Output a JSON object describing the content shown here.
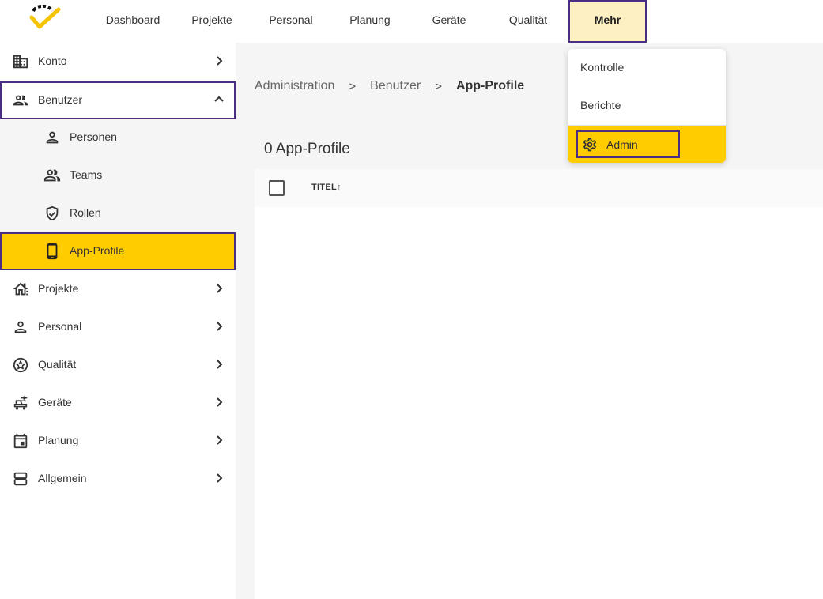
{
  "nav": {
    "items": [
      {
        "label": "Dashboard"
      },
      {
        "label": "Projekte"
      },
      {
        "label": "Personal"
      },
      {
        "label": "Planung"
      },
      {
        "label": "Geräte"
      },
      {
        "label": "Qualität"
      },
      {
        "label": "Mehr"
      }
    ],
    "active": "Mehr"
  },
  "sidebar": {
    "items": [
      {
        "label": "Konto",
        "icon": "building-icon"
      },
      {
        "label": "Benutzer",
        "icon": "users-icon",
        "expanded": true
      },
      {
        "label": "Personen",
        "icon": "person-icon",
        "sub": true
      },
      {
        "label": "Teams",
        "icon": "group-icon",
        "sub": true
      },
      {
        "label": "Rollen",
        "icon": "shield-check-icon",
        "sub": true
      },
      {
        "label": "App-Profile",
        "icon": "smartphone-icon",
        "sub": true,
        "selected": true
      },
      {
        "label": "Projekte",
        "icon": "city-icon"
      },
      {
        "label": "Personal",
        "icon": "person-icon"
      },
      {
        "label": "Qualität",
        "icon": "star-badge-icon"
      },
      {
        "label": "Geräte",
        "icon": "equipment-icon"
      },
      {
        "label": "Planung",
        "icon": "calendar-icon"
      },
      {
        "label": "Allgemein",
        "icon": "storage-icon"
      }
    ]
  },
  "breadcrumb": {
    "items": [
      "Administration",
      "Benutzer",
      "App-Profile"
    ],
    "separator": ">"
  },
  "main": {
    "count_title": "0 App-Profile",
    "table": {
      "columns": [
        {
          "label": "TITEL",
          "sort": "↑"
        }
      ],
      "rows": []
    }
  },
  "dropdown": {
    "items": [
      {
        "label": "Kontrolle"
      },
      {
        "label": "Berichte"
      },
      {
        "label": "Admin",
        "icon": "gear-icon",
        "highlighted": true
      }
    ]
  },
  "colors": {
    "accent": "#ffcc00",
    "highlight_border": "#4b2e83",
    "active_nav_bg": "#fdf1c4",
    "logo_yellow": "#f5c400"
  }
}
